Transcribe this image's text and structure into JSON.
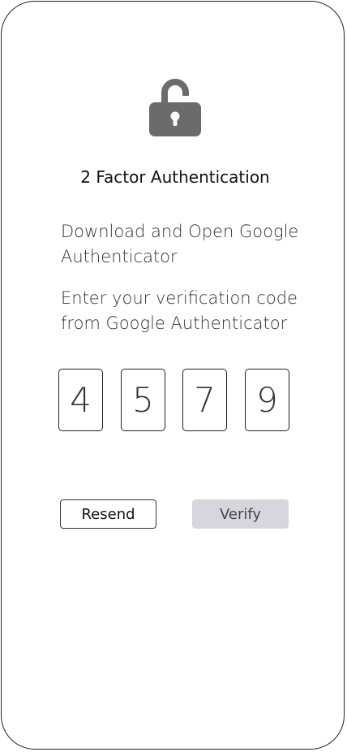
{
  "screen": {
    "title": "2 Factor Authentication",
    "instructions": [
      "Download and Open Google\nAuthenticator",
      "Enter your verification code\nfrom Google Authenticator"
    ],
    "code_digits": [
      "4",
      "5",
      "7",
      "9"
    ],
    "resend_label": "Resend",
    "verify_label": "Verify",
    "icon": "unlocked-padlock-icon"
  },
  "colors": {
    "lock": "#6b6b6b",
    "verify_bg": "#d6d7de",
    "border": "#222222"
  }
}
